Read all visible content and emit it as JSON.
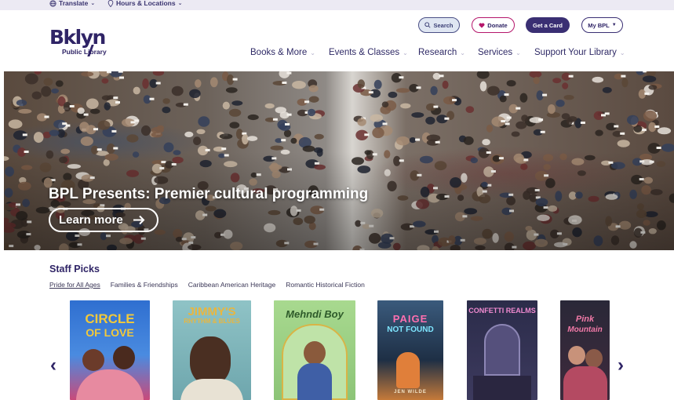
{
  "utility": {
    "translate": "Translate",
    "hours": "Hours & Locations"
  },
  "logo": {
    "big": "Bklyn",
    "small": "Public Library"
  },
  "header_buttons": {
    "search": "Search",
    "donate": "Donate",
    "card": "Get a Card",
    "mybpl": "My BPL"
  },
  "nav": [
    {
      "label": "Books & More"
    },
    {
      "label": "Events & Classes"
    },
    {
      "label": "Research"
    },
    {
      "label": "Services"
    },
    {
      "label": "Support Your Library"
    }
  ],
  "hero": {
    "title": "BPL Presents: Premier cultural programming",
    "button": "Learn more"
  },
  "staff_picks": {
    "title": "Staff Picks",
    "tabs": [
      {
        "label": "Pride for All Ages",
        "active": true
      },
      {
        "label": "Families & Friendships",
        "active": false
      },
      {
        "label": "Caribbean American Heritage",
        "active": false
      },
      {
        "label": "Romantic Historical Fiction",
        "active": false
      }
    ],
    "books": [
      {
        "title_line1": "CIRCLE",
        "title_line2": "OF LOVE",
        "bg": "#2f6fd0"
      },
      {
        "title_line1": "JIMMY'S",
        "title_line2": "RHYTHM & BLUES",
        "bg": "#7fb3b8"
      },
      {
        "title_line1": "Mehndi Boy",
        "title_line2": "",
        "bg": "#9ccf86"
      },
      {
        "title_line1": "PAIGE",
        "title_line2": "NOT FOUND",
        "author": "JEN WILDE",
        "bg": "#27405c"
      },
      {
        "title_line1": "CONFETTI REALMS",
        "title_line2": "",
        "bg": "#2b2c4a"
      },
      {
        "title_line1": "Pink",
        "title_line2": "Mountain",
        "bg": "#2a2838"
      }
    ]
  },
  "colors": {
    "brand": "#2f2466",
    "donate_border": "#b5166b",
    "card_bg": "#3a2f73"
  }
}
